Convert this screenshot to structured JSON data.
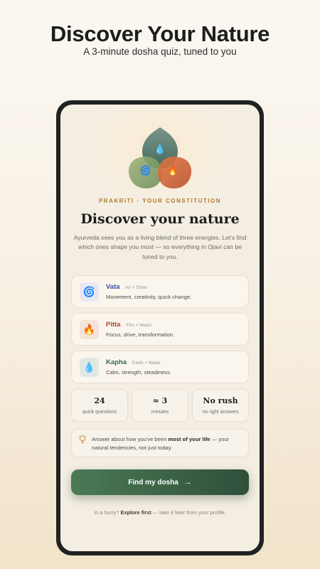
{
  "promo": {
    "headline": "Discover Your Nature",
    "subheadline": "A 3-minute dosha quiz, tuned to you"
  },
  "screen": {
    "kicker": "PRAKRITI · YOUR CONSTITUTION",
    "title": "Discover your nature",
    "intro": "Ayurveda sees you as a living blend of three energies. Let's find which ones shape you most — so everything in Ojavi can be tuned to you.",
    "doshas": [
      {
        "name": "Vata",
        "elements": "· Air + Ether",
        "description": "Movement, creativity, quick change.",
        "icon": "spiral-icon",
        "glyph": "🌀",
        "color": "#3d4fa3",
        "tile": "#e9e8f2"
      },
      {
        "name": "Pitta",
        "elements": "· Fire + Water",
        "description": "Focus, drive, transformation.",
        "icon": "flame-icon",
        "glyph": "🔥",
        "color": "#b0442a",
        "tile": "#f3e3d8"
      },
      {
        "name": "Kapha",
        "elements": "· Earth + Water",
        "description": "Calm, strength, steadiness.",
        "icon": "droplet-icon",
        "glyph": "💧",
        "color": "#2f6a5a",
        "tile": "#e1e8e4"
      }
    ],
    "stats": [
      {
        "value": "24",
        "label": "quick questions"
      },
      {
        "value": "≈ 3",
        "label": "minutes"
      },
      {
        "value": "No rush",
        "label": "no right answers"
      }
    ],
    "tip": {
      "prefix": "Answer about how you've been ",
      "emphasis": "most of your life",
      "suffix": " — your natural tendencies, not just today."
    },
    "cta_label": "Find my dosha",
    "footer": {
      "prefix": "In a hurry? ",
      "link": "Explore first",
      "suffix": " — take it later from your profile."
    }
  }
}
